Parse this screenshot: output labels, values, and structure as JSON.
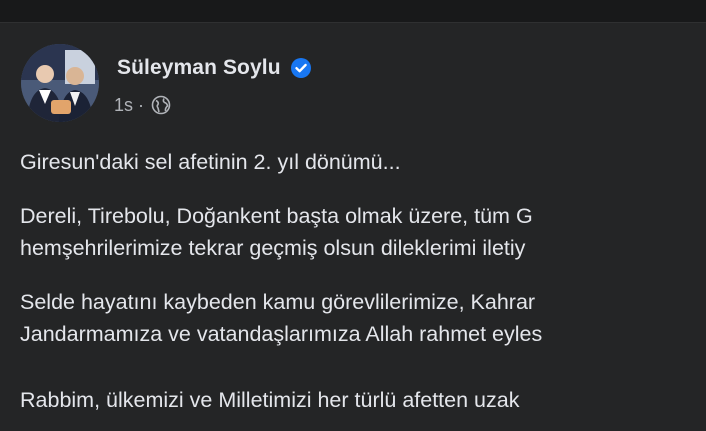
{
  "post": {
    "author": {
      "name": "Süleyman Soylu",
      "verified": true,
      "avatar_icon": "profile-photo"
    },
    "meta": {
      "timestamp": "1s",
      "separator": "·",
      "audience_icon": "globe-icon"
    },
    "paragraphs": [
      {
        "lines": [
          "Giresun'daki sel afetinin 2. yıl dönümü..."
        ]
      },
      {
        "lines": [
          "Dereli, Tirebolu, Doğankent başta olmak üzere, tüm G",
          "hemşehrilerimize tekrar geçmiş olsun dileklerimi iletiy"
        ]
      },
      {
        "lines": [
          "Selde hayatını kaybeden kamu görevlilerimize, Kahrar",
          "Jandarmamıza ve vatandaşlarımıza Allah rahmet eyles"
        ]
      },
      {
        "lines": [
          "Rabbim, ülkemizi ve Milletimizi her türlü afetten uzak"
        ]
      }
    ]
  },
  "colors": {
    "background": "#18191a",
    "card": "#242526",
    "primary_text": "#e4e6eb",
    "secondary_text": "#b0b3b8",
    "verified_badge": "#1877f2"
  }
}
